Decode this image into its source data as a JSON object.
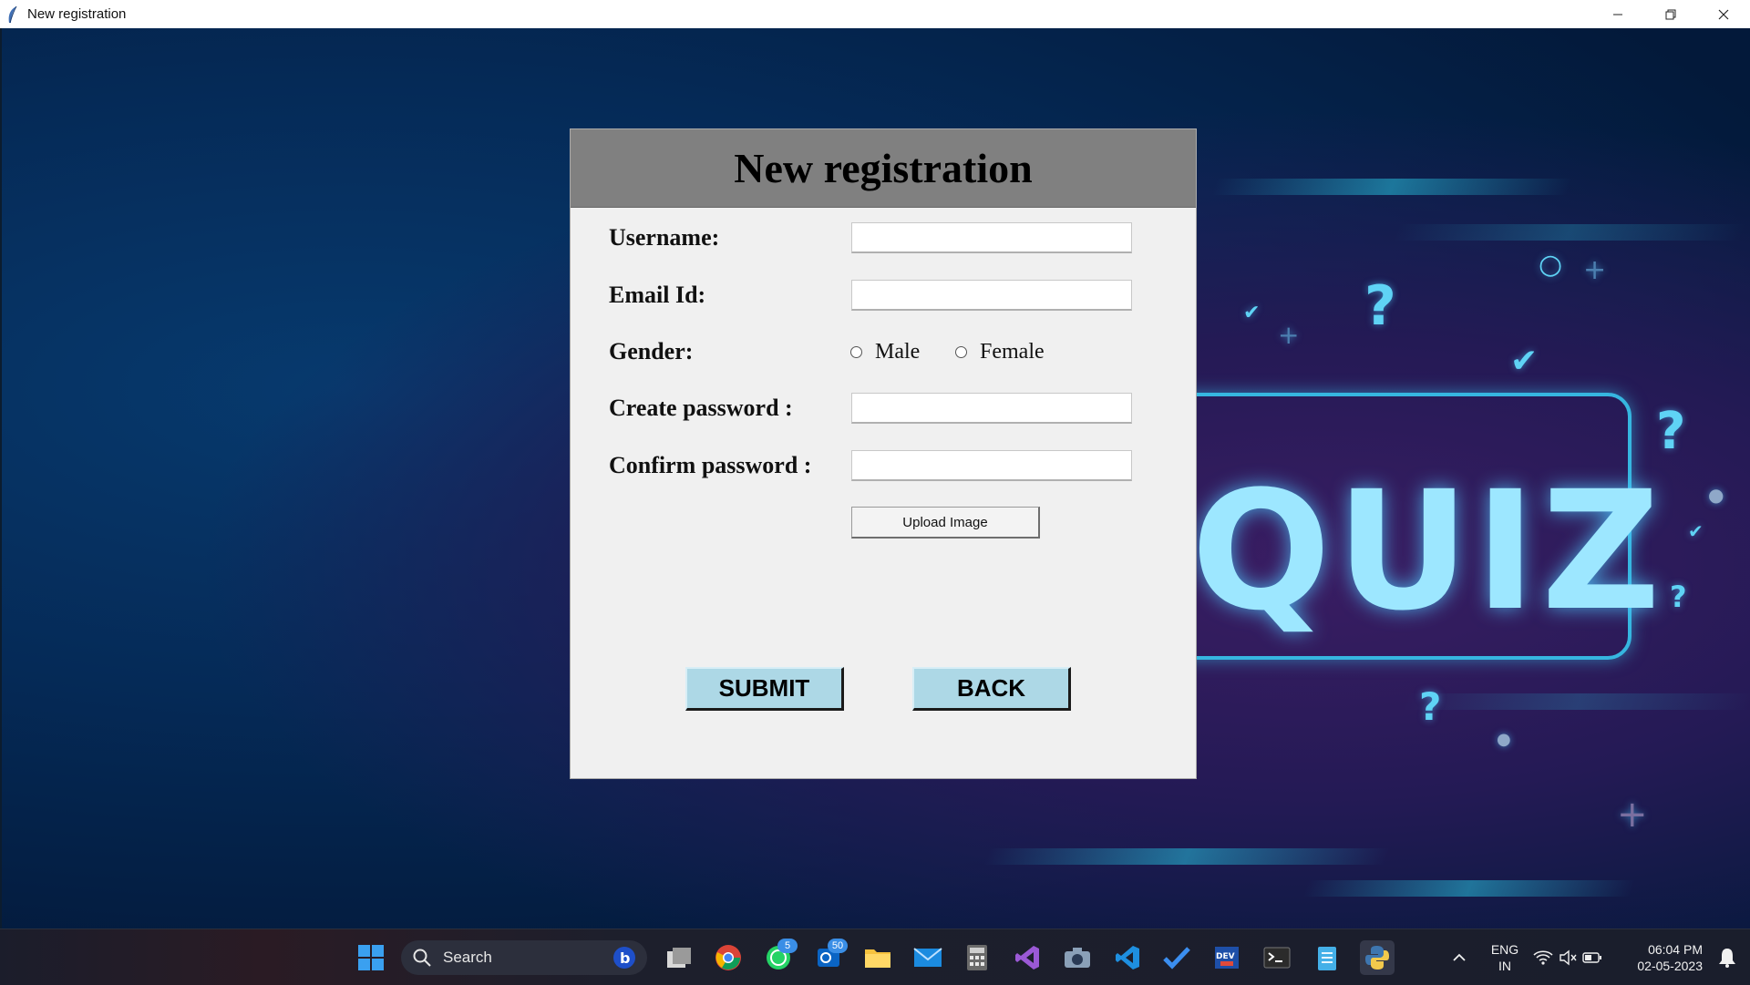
{
  "window": {
    "title": "New registration"
  },
  "background": {
    "quiz_text": "QUIZ"
  },
  "dialog": {
    "heading": "New registration",
    "fields": {
      "username_label": "Username:",
      "email_label": "Email Id:",
      "gender_label": "Gender:",
      "create_password_label": "Create password :",
      "confirm_password_label": "Confirm password :"
    },
    "gender_options": [
      "Male",
      "Female"
    ],
    "upload_label": "Upload Image",
    "submit_label": "SUBMIT",
    "back_label": "BACK"
  },
  "taskbar": {
    "search_label": "Search",
    "badges": {
      "whatsapp": "5",
      "outlook": "50"
    },
    "language": "ENG",
    "region": "IN",
    "time": "06:04 PM",
    "date": "02-05-2023"
  },
  "colors": {
    "button_accent": "#add8e6",
    "header_bg": "#808080",
    "dialog_bg": "#f0f0f0"
  }
}
